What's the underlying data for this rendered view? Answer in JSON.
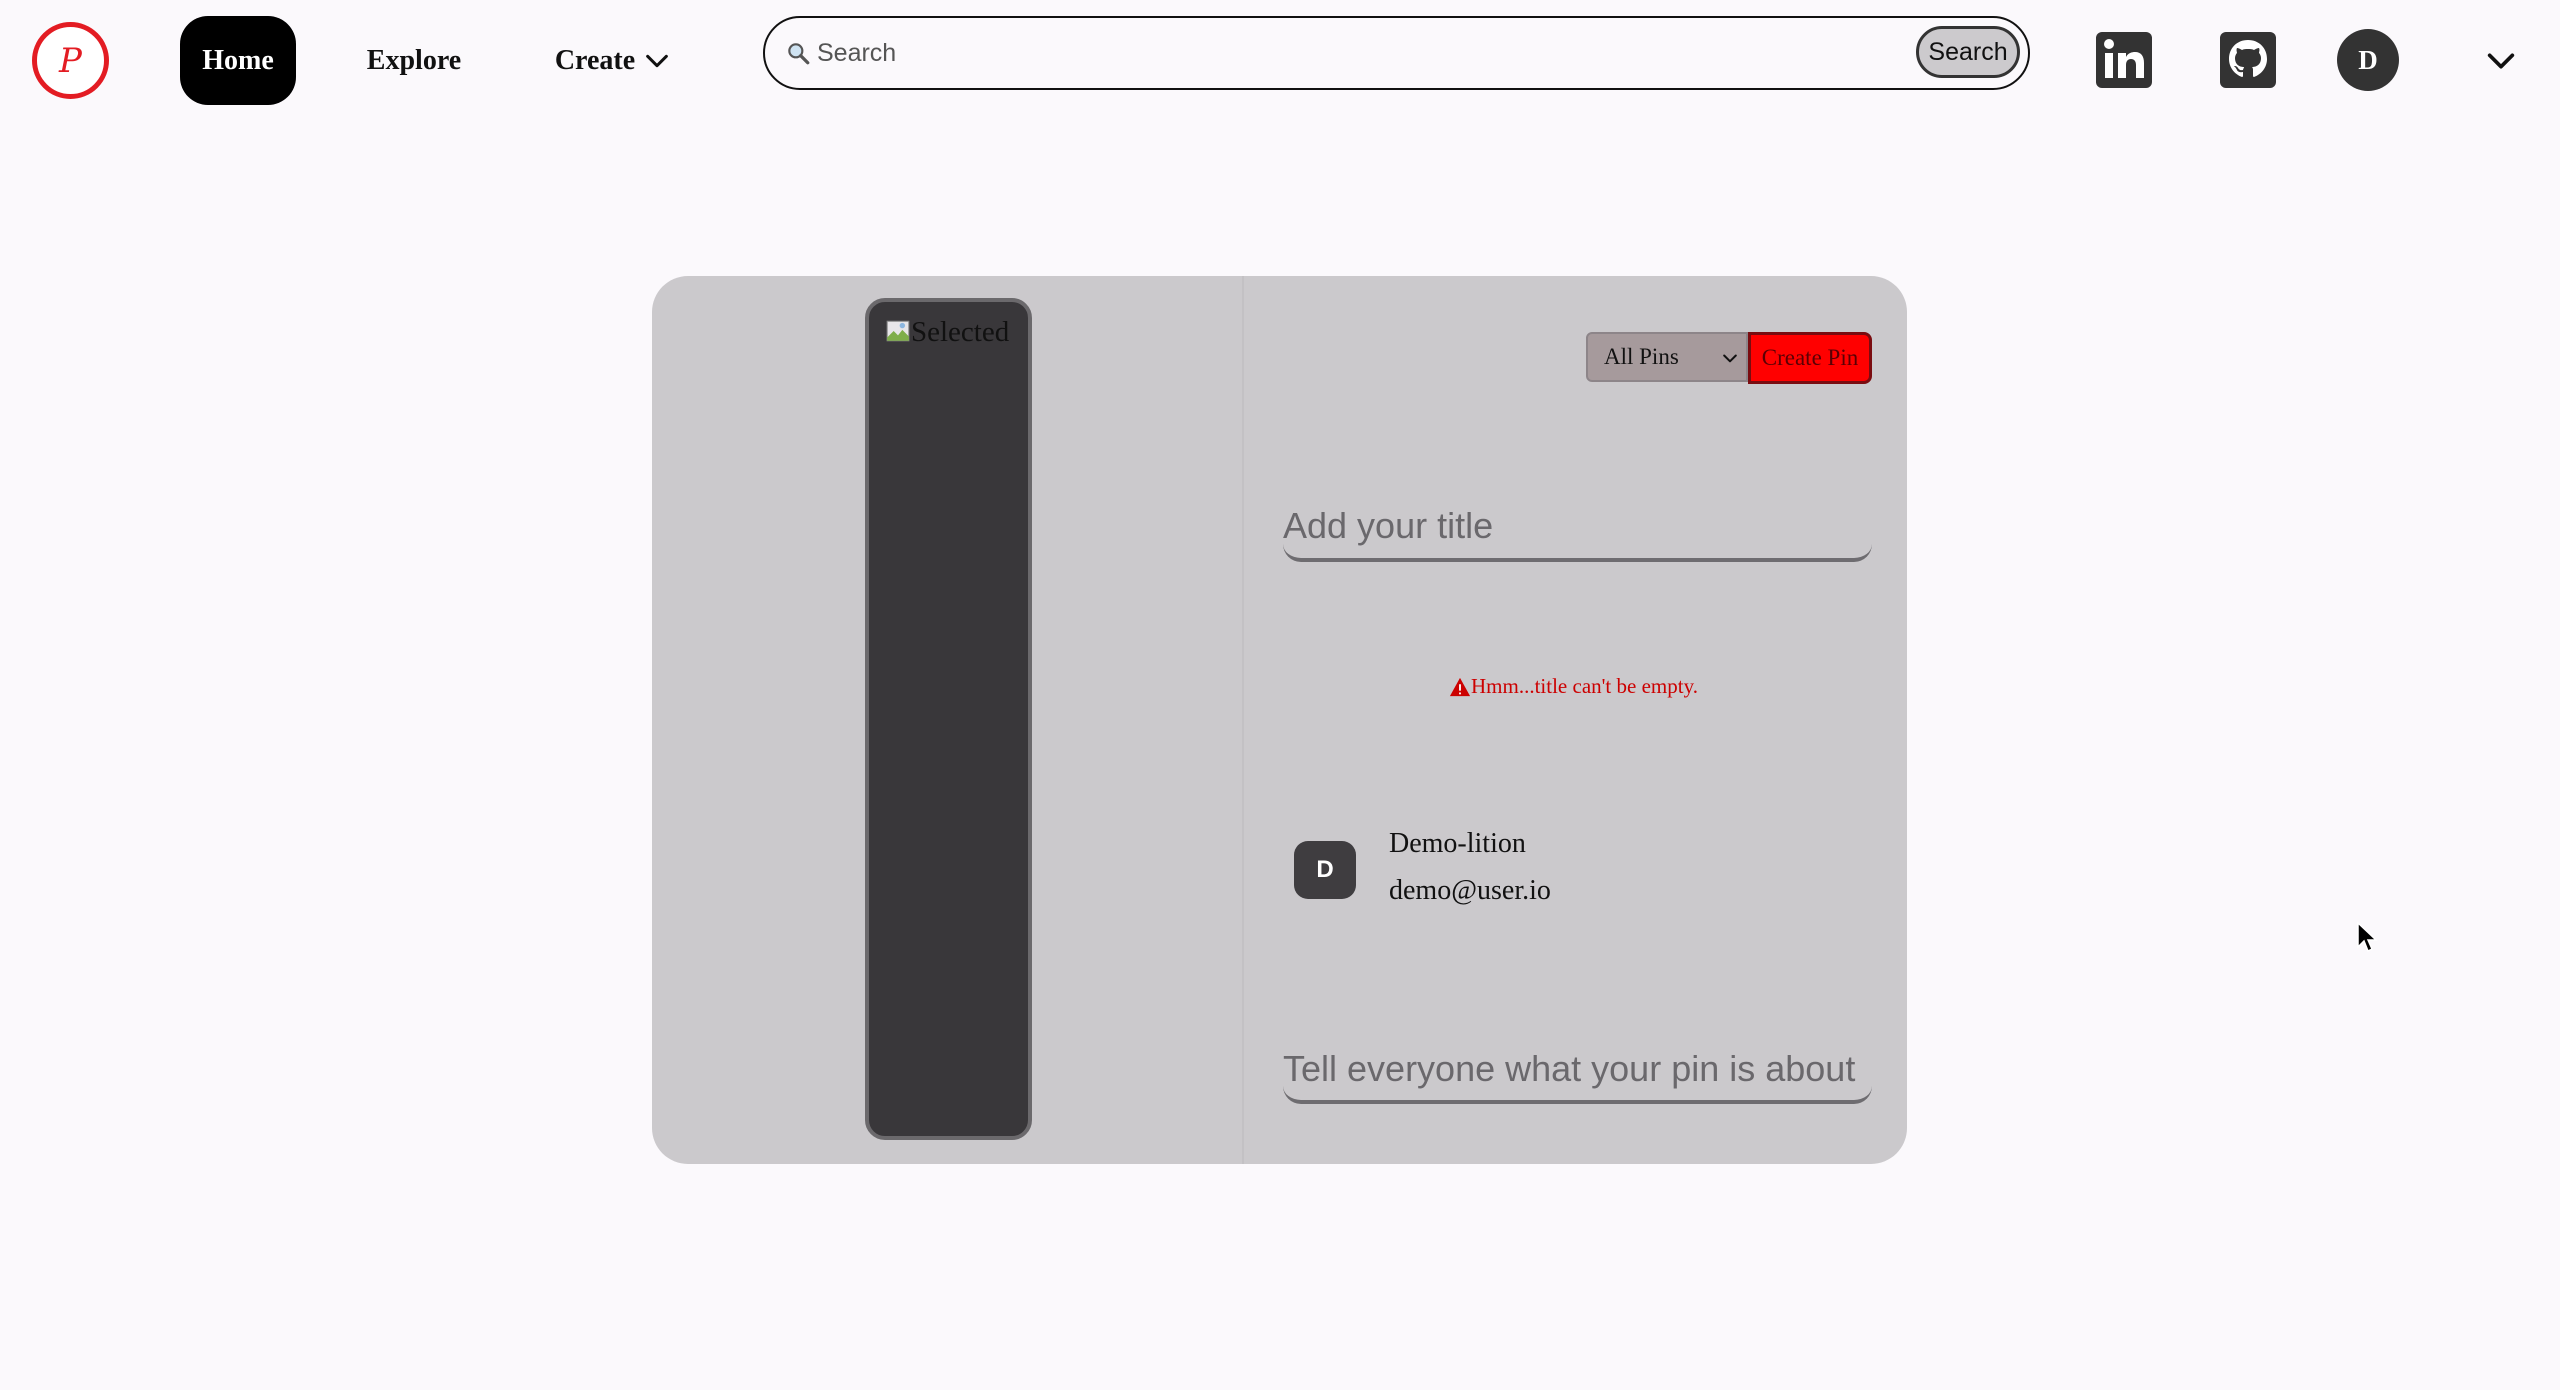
{
  "nav": {
    "logo_letter": "P",
    "home_label": "Home",
    "explore_label": "Explore",
    "create_label": "Create",
    "search_placeholder": "Search",
    "search_button": "Search",
    "avatar_initial": "D"
  },
  "pin_form": {
    "image_alt": "Selected",
    "board_select": "All Pins",
    "create_pin_button": "Create Pin",
    "title_placeholder": "Add your title",
    "error_message": "Hmm...title can't be empty.",
    "user": {
      "initial": "D",
      "name": "Demo-lition",
      "email": "demo@user.io"
    },
    "description_placeholder": "Tell everyone what your pin is about"
  },
  "colors": {
    "accent": "#e31c23",
    "card_bg": "#cbc9cc",
    "create_pin_bg": "#ff0000",
    "error": "#cc0000"
  }
}
